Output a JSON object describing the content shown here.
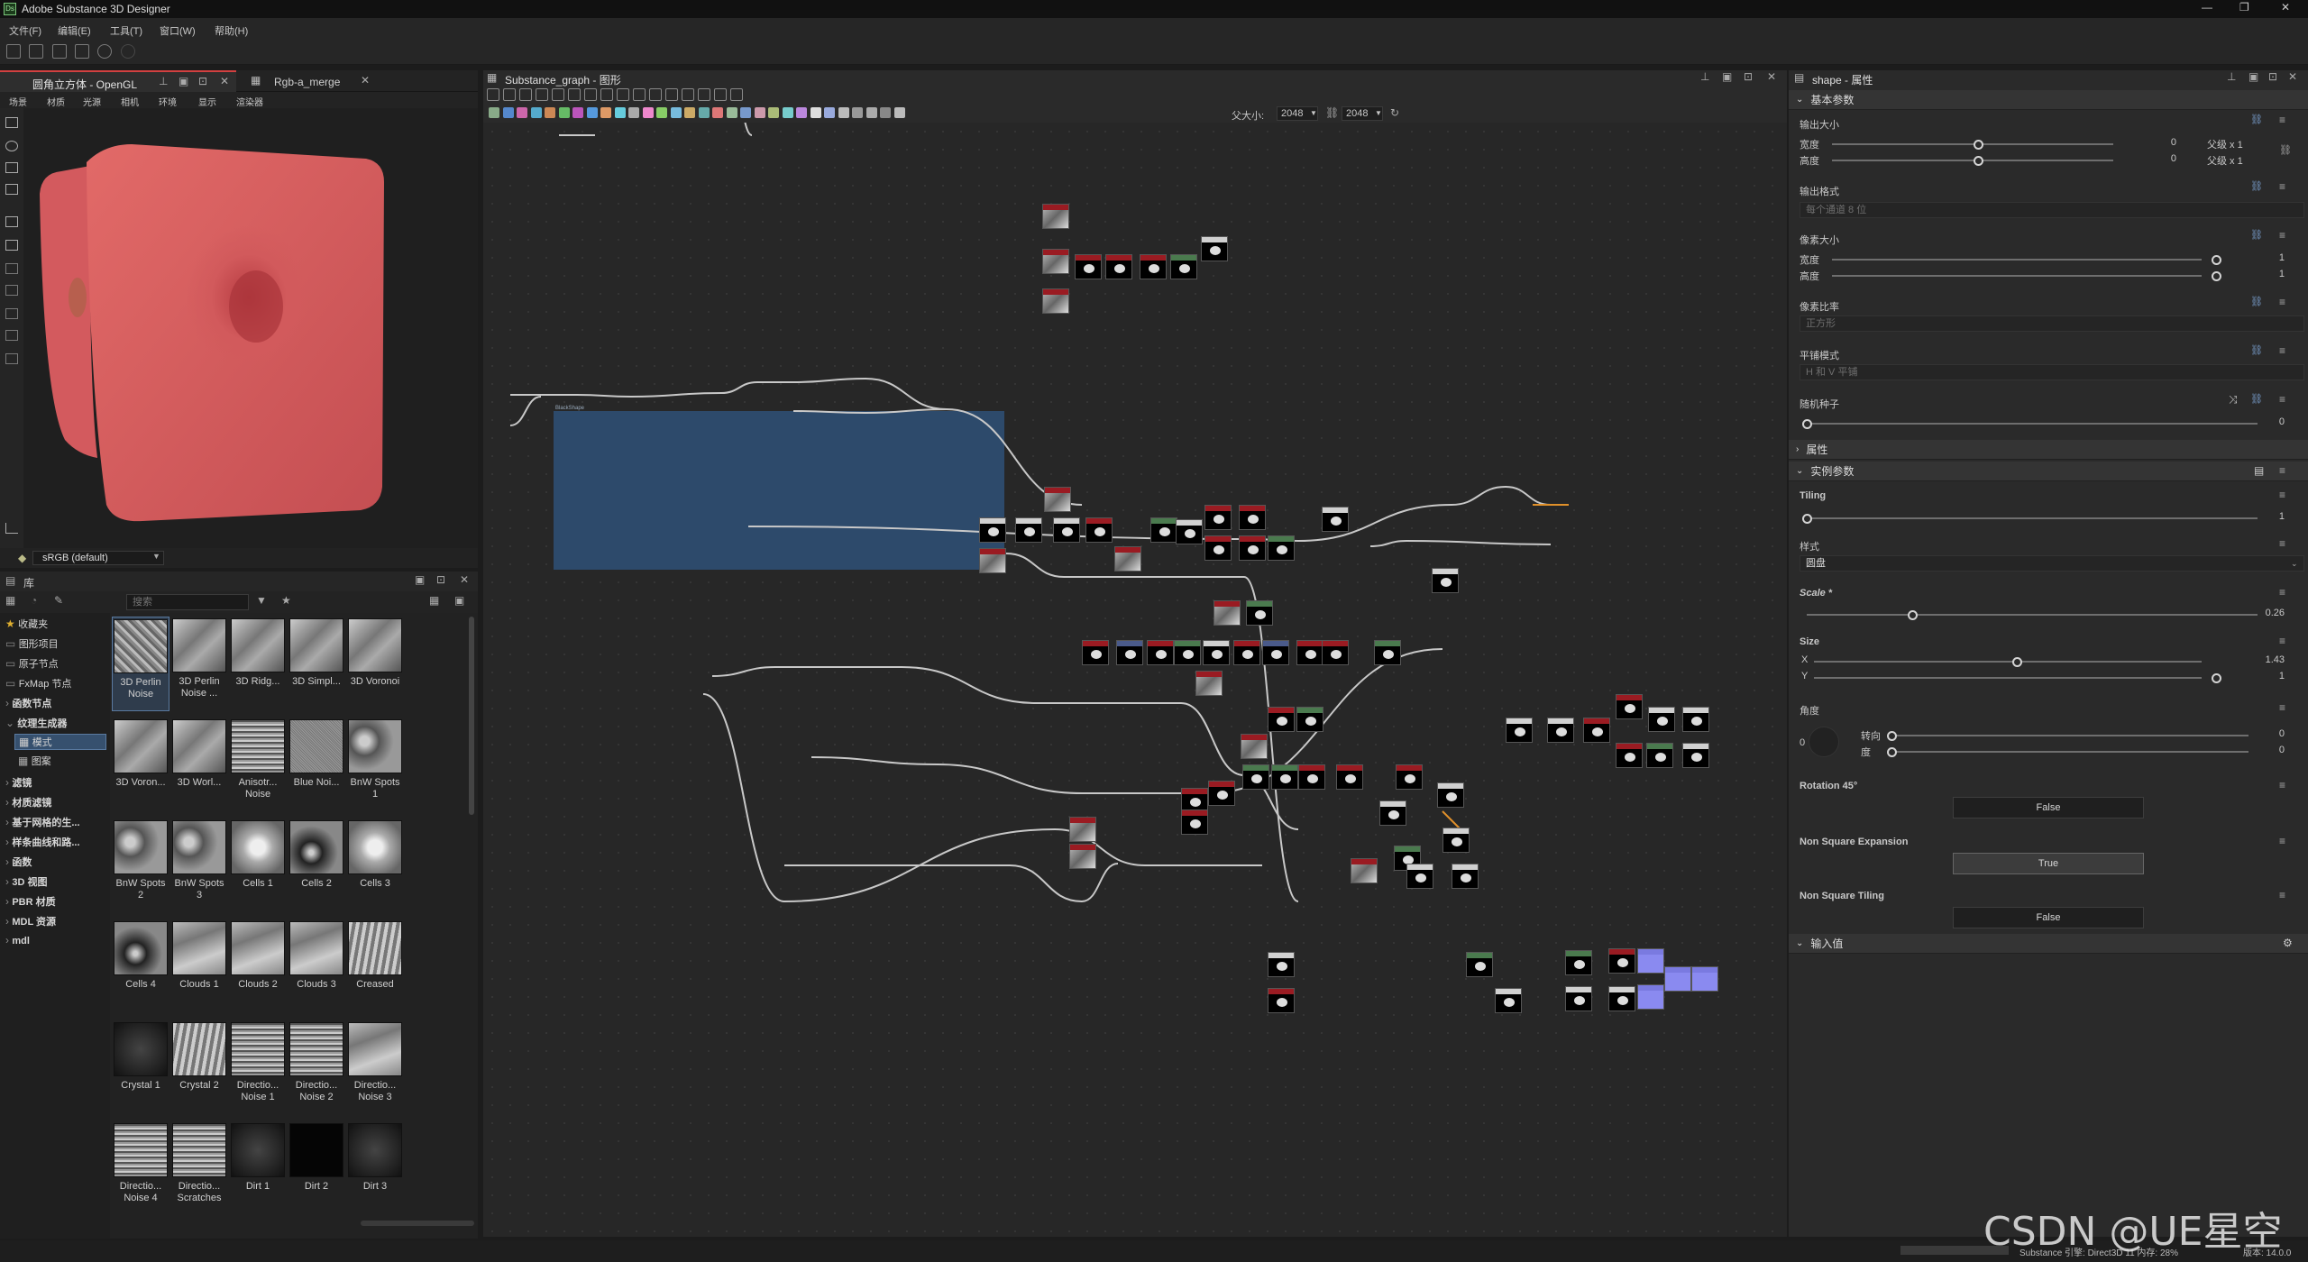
{
  "app": {
    "title": "Adobe Substance 3D Designer",
    "menus": [
      "文件(F)",
      "编辑(E)",
      "工具(T)",
      "窗口(W)",
      "帮助(H)"
    ],
    "window_controls": [
      "minimize-icon",
      "restore-icon",
      "close-icon"
    ]
  },
  "viewport": {
    "tabs": [
      "圆角立方体 - OpenGL",
      "Rgb-a_merge"
    ],
    "menu": [
      "场景",
      "材质",
      "光源",
      "相机",
      "环境",
      "显示",
      "渲染器"
    ],
    "colorspace": "sRGB (default)"
  },
  "library": {
    "title": "库",
    "search_placeholder": "搜索",
    "tree": [
      "收藏夹",
      "图形项目",
      "原子节点",
      "FxMap 节点",
      "函数节点",
      "纹理生成器",
      "模式",
      "图案",
      "滤镜",
      "材质滤镜",
      "基于网格的生...",
      "样条曲线和路...",
      "函数",
      "3D 视图",
      "PBR 材质",
      "MDL 资源",
      "mdl"
    ],
    "items": [
      {
        "label": "3D Perlin Noise",
        "thumb": "noise"
      },
      {
        "label": "3D Perlin Noise ...",
        "thumb": "noise3d"
      },
      {
        "label": "3D Ridg...",
        "thumb": "noise3d"
      },
      {
        "label": "3D Simpl...",
        "thumb": "noise3d"
      },
      {
        "label": "3D Voronoi",
        "thumb": "noise3d"
      },
      {
        "label": "3D Voron...",
        "thumb": "noise3d"
      },
      {
        "label": "3D Worl...",
        "thumb": "noise3d"
      },
      {
        "label": "Anisotr... Noise",
        "thumb": "aniso"
      },
      {
        "label": "Blue Noi...",
        "thumb": "blue"
      },
      {
        "label": "BnW Spots 1",
        "thumb": "spots"
      },
      {
        "label": "BnW Spots 2",
        "thumb": "spots"
      },
      {
        "label": "BnW Spots 3",
        "thumb": "spots"
      },
      {
        "label": "Cells 1",
        "thumb": "cells"
      },
      {
        "label": "Cells 2",
        "thumb": "cellsdark"
      },
      {
        "label": "Cells 3",
        "thumb": "cells"
      },
      {
        "label": "Cells 4",
        "thumb": "cellsdark"
      },
      {
        "label": "Clouds 1",
        "thumb": "clouds"
      },
      {
        "label": "Clouds 2",
        "thumb": "clouds"
      },
      {
        "label": "Clouds 3",
        "thumb": "clouds"
      },
      {
        "label": "Creased",
        "thumb": "creased"
      },
      {
        "label": "Crystal 1",
        "thumb": "dark"
      },
      {
        "label": "Crystal 2",
        "thumb": "creased"
      },
      {
        "label": "Directio... Noise 1",
        "thumb": "aniso"
      },
      {
        "label": "Directio... Noise 2",
        "thumb": "aniso"
      },
      {
        "label": "Directio... Noise 3",
        "thumb": "clouds"
      },
      {
        "label": "Directio... Noise 4",
        "thumb": "aniso"
      },
      {
        "label": "Directio... Scratches",
        "thumb": "aniso"
      },
      {
        "label": "Dirt 1",
        "thumb": "dark"
      },
      {
        "label": "Dirt 2",
        "thumb": "black"
      },
      {
        "label": "Dirt 3",
        "thumb": "dark"
      }
    ]
  },
  "graph": {
    "tab": "Substance_graph - 图形",
    "parent_size_label": "父大小:",
    "size_w": "2048",
    "size_h": "2048",
    "frame_title": "BlackShape"
  },
  "properties": {
    "tab": "shape - 属性",
    "sections": {
      "basic": "基本参数",
      "attributes": "属性",
      "instance": "实例参数",
      "inputs": "输入值"
    },
    "output_size": {
      "label": "输出大小",
      "width_label": "宽度",
      "height_label": "高度",
      "width_value": "0",
      "height_value": "0",
      "width_mode": "父级 x 1",
      "height_mode": "父级 x 1"
    },
    "output_format": {
      "label": "输出格式",
      "value": "每个通道 8 位"
    },
    "pixel_size": {
      "label": "像素大小",
      "width_label": "宽度",
      "height_label": "高度",
      "width_value": "1",
      "height_value": "1"
    },
    "pixel_ratio": {
      "label": "像素比率",
      "value": "正方形"
    },
    "tiling_mode": {
      "label": "平铺模式",
      "value": "H 和 V 平铺"
    },
    "random_seed": {
      "label": "随机种子",
      "value": "0"
    },
    "tiling": {
      "label": "Tiling",
      "value": "1"
    },
    "pattern": {
      "label": "样式",
      "value": "圆盘"
    },
    "scale": {
      "label": "Scale *",
      "value": "0.26"
    },
    "size": {
      "label": "Size",
      "x_label": "X",
      "y_label": "Y",
      "x_value": "1.43",
      "y_value": "1"
    },
    "angle": {
      "label": "角度",
      "dial_value": "0",
      "turns_label": "转向",
      "degrees_label": "度",
      "turns_value": "0",
      "degrees_value": "0"
    },
    "rotation45": {
      "label": "Rotation 45°",
      "value": "False"
    },
    "non_square_expansion": {
      "label": "Non Square Expansion",
      "value": "True"
    },
    "non_square_tiling": {
      "label": "Non Square Tiling",
      "value": "False"
    }
  },
  "status": {
    "engine": "Substance 引擎: Direct3D 11 内存: 28%",
    "version": "版本: 14.0.0"
  },
  "watermark": "CSDN @UE星空",
  "colors": {
    "frame": "#2d4a6b",
    "node_header_red": "#9a1b22",
    "node_header_green": "#4a7a4e",
    "wire": "#c8c8c8",
    "wire_orange": "#e0902a",
    "cube": "#d95c5c"
  }
}
